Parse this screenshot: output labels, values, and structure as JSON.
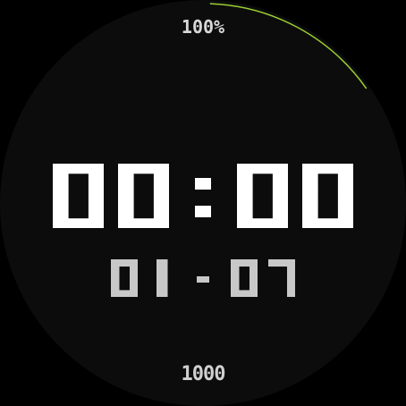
{
  "battery": {
    "label": "100%",
    "level": 1.0
  },
  "time": {
    "text": "00:00",
    "hours": "00",
    "separator": ":",
    "minutes": "00"
  },
  "date": {
    "text": "01-07",
    "month": "01",
    "separator": "-",
    "day": "07"
  },
  "steps": {
    "label": "1000"
  },
  "colors": {
    "face_background": "#0c0c0c",
    "time_color": "#ffffff",
    "date_color": "#c8c8c8",
    "arc_color": "#9acd32"
  }
}
